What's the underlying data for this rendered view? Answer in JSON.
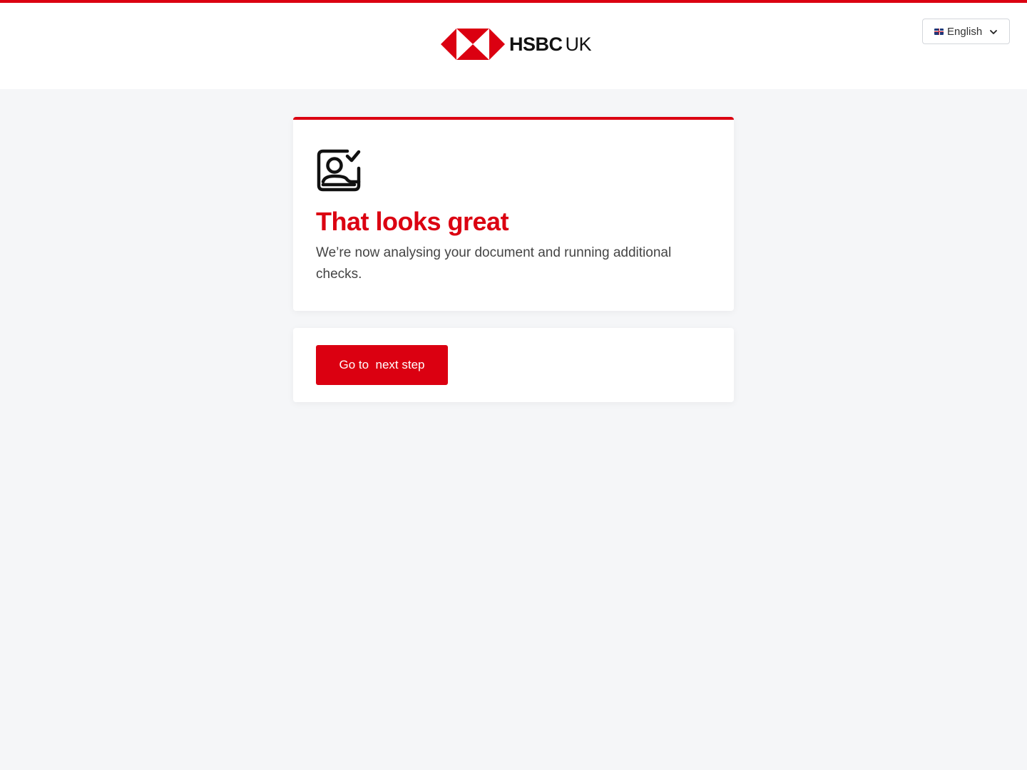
{
  "header": {
    "logo": {
      "brand": "HSBC",
      "region": "UK",
      "icon": "hsbc-hexagon-logo"
    },
    "language_selector": {
      "flag": "uk-flag-icon",
      "selected": "English",
      "icon": "chevron-down-icon"
    }
  },
  "status_card": {
    "icon": "id-card-checked-icon",
    "title": "That looks great",
    "body": "We’re now analysing your document and running additional checks."
  },
  "action_card": {
    "next_button_label": "Go to  next step"
  },
  "colors": {
    "brand_red": "#db0011",
    "background": "#f5f6f8",
    "card": "#ffffff",
    "text_dark": "#111111",
    "text_body": "#444444"
  }
}
